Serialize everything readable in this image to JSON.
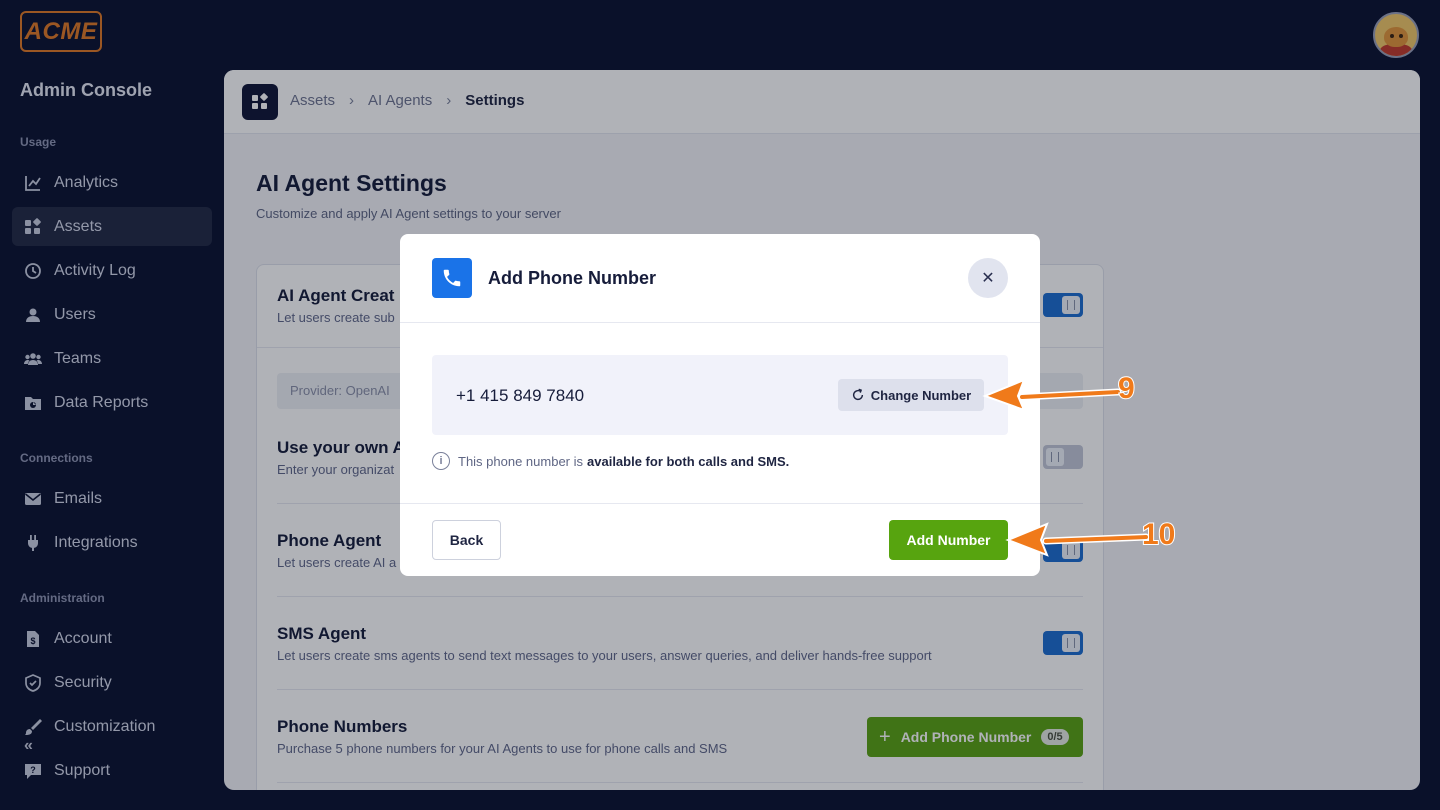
{
  "brand": {
    "logo_text": "ACME"
  },
  "sidebar": {
    "title": "Admin Console",
    "sections": {
      "usage": "Usage",
      "connections": "Connections",
      "administration": "Administration"
    },
    "items": [
      {
        "label": "Analytics",
        "icon": "chart-line-icon"
      },
      {
        "label": "Assets",
        "icon": "grid-icon",
        "active": true
      },
      {
        "label": "Activity Log",
        "icon": "history-icon"
      },
      {
        "label": "Users",
        "icon": "user-icon"
      },
      {
        "label": "Teams",
        "icon": "team-icon"
      },
      {
        "label": "Data Reports",
        "icon": "folder-chart-icon"
      },
      {
        "label": "Emails",
        "icon": "envelope-icon"
      },
      {
        "label": "Integrations",
        "icon": "plug-icon"
      },
      {
        "label": "Account",
        "icon": "document-dollar-icon"
      },
      {
        "label": "Security",
        "icon": "shield-icon"
      },
      {
        "label": "Customization",
        "icon": "brush-icon"
      },
      {
        "label": "Support",
        "icon": "chat-question-icon"
      }
    ],
    "collapse_glyph": "«"
  },
  "breadcrumb": {
    "items": [
      "Assets",
      "AI Agents",
      "Settings"
    ],
    "separator": "›"
  },
  "page": {
    "title": "AI Agent Settings",
    "subtitle": "Customize and apply AI Agent settings to your server"
  },
  "settings": {
    "ai_agent_creation": {
      "title": "AI Agent Creat",
      "desc": "Let users create sub"
    },
    "provider_text": "Provider: OpenAI",
    "own_key": {
      "title": "Use your own A",
      "desc": "Enter your organizat"
    },
    "phone_agent": {
      "title": "Phone Agent",
      "desc": "Let users create AI a"
    },
    "sms_agent": {
      "title": "SMS Agent",
      "desc": "Let users create sms agents to send text messages to your users, answer queries, and deliver hands-free support"
    },
    "phone_numbers": {
      "title": "Phone Numbers",
      "desc": "Purchase 5 phone numbers for your AI Agents to use for phone calls and SMS",
      "button_label": "Add Phone Number",
      "count_badge": "0/5"
    }
  },
  "modal": {
    "title": "Add Phone Number",
    "close_glyph": "✕",
    "phone_number": "+1 415 849 7840",
    "change_button": "Change Number",
    "info_text": "This phone number is",
    "info_bold": "available for both calls and SMS.",
    "back_button": "Back",
    "add_button": "Add Number"
  },
  "annotations": {
    "step_9": "9",
    "step_10": "10",
    "color": "#f07a1a"
  }
}
